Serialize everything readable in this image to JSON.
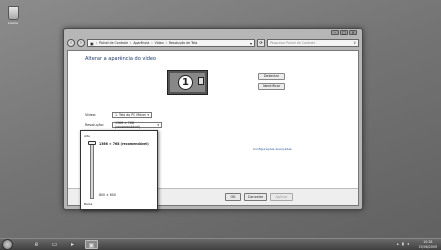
{
  "desktop": {
    "recycle_label": "Lixeira"
  },
  "window": {
    "controls": {
      "minimize": "–",
      "maximize": "□",
      "close": "✕"
    },
    "nav": {
      "back": "‹",
      "forward": "›"
    },
    "breadcrumb": [
      "Painel de Controle",
      "Aparência",
      "Vídeo",
      "Resolução de Tela"
    ],
    "search_placeholder": "Pesquisar Painel de Controle",
    "page_title": "Alterar a aparência do vídeo",
    "monitor_number": "1",
    "buttons": {
      "detect": "Detectar",
      "identify": "Identificar"
    },
    "fields": {
      "video_label": "Vídeo:",
      "video_value": "1. Tela do PC Móvel",
      "resolution_label": "Resolução:",
      "resolution_value": "1366 × 768 (recomendável)",
      "orientation_label": "Orientação:"
    },
    "advanced_link": "Configurações avançadas",
    "faded_texts": [
      "Ampliar ou reduzir",
      "Quais configurações"
    ],
    "footer": {
      "ok": "OK",
      "cancel": "Cancelar",
      "apply": "Aplicar"
    }
  },
  "resolution_popup": {
    "high": "Alta",
    "low": "Baixa",
    "options": [
      "1366 × 768 (recomendável)",
      "800 × 600"
    ]
  },
  "taskbar": {
    "clock_time": "10:28",
    "clock_date": "25/06/2009"
  }
}
